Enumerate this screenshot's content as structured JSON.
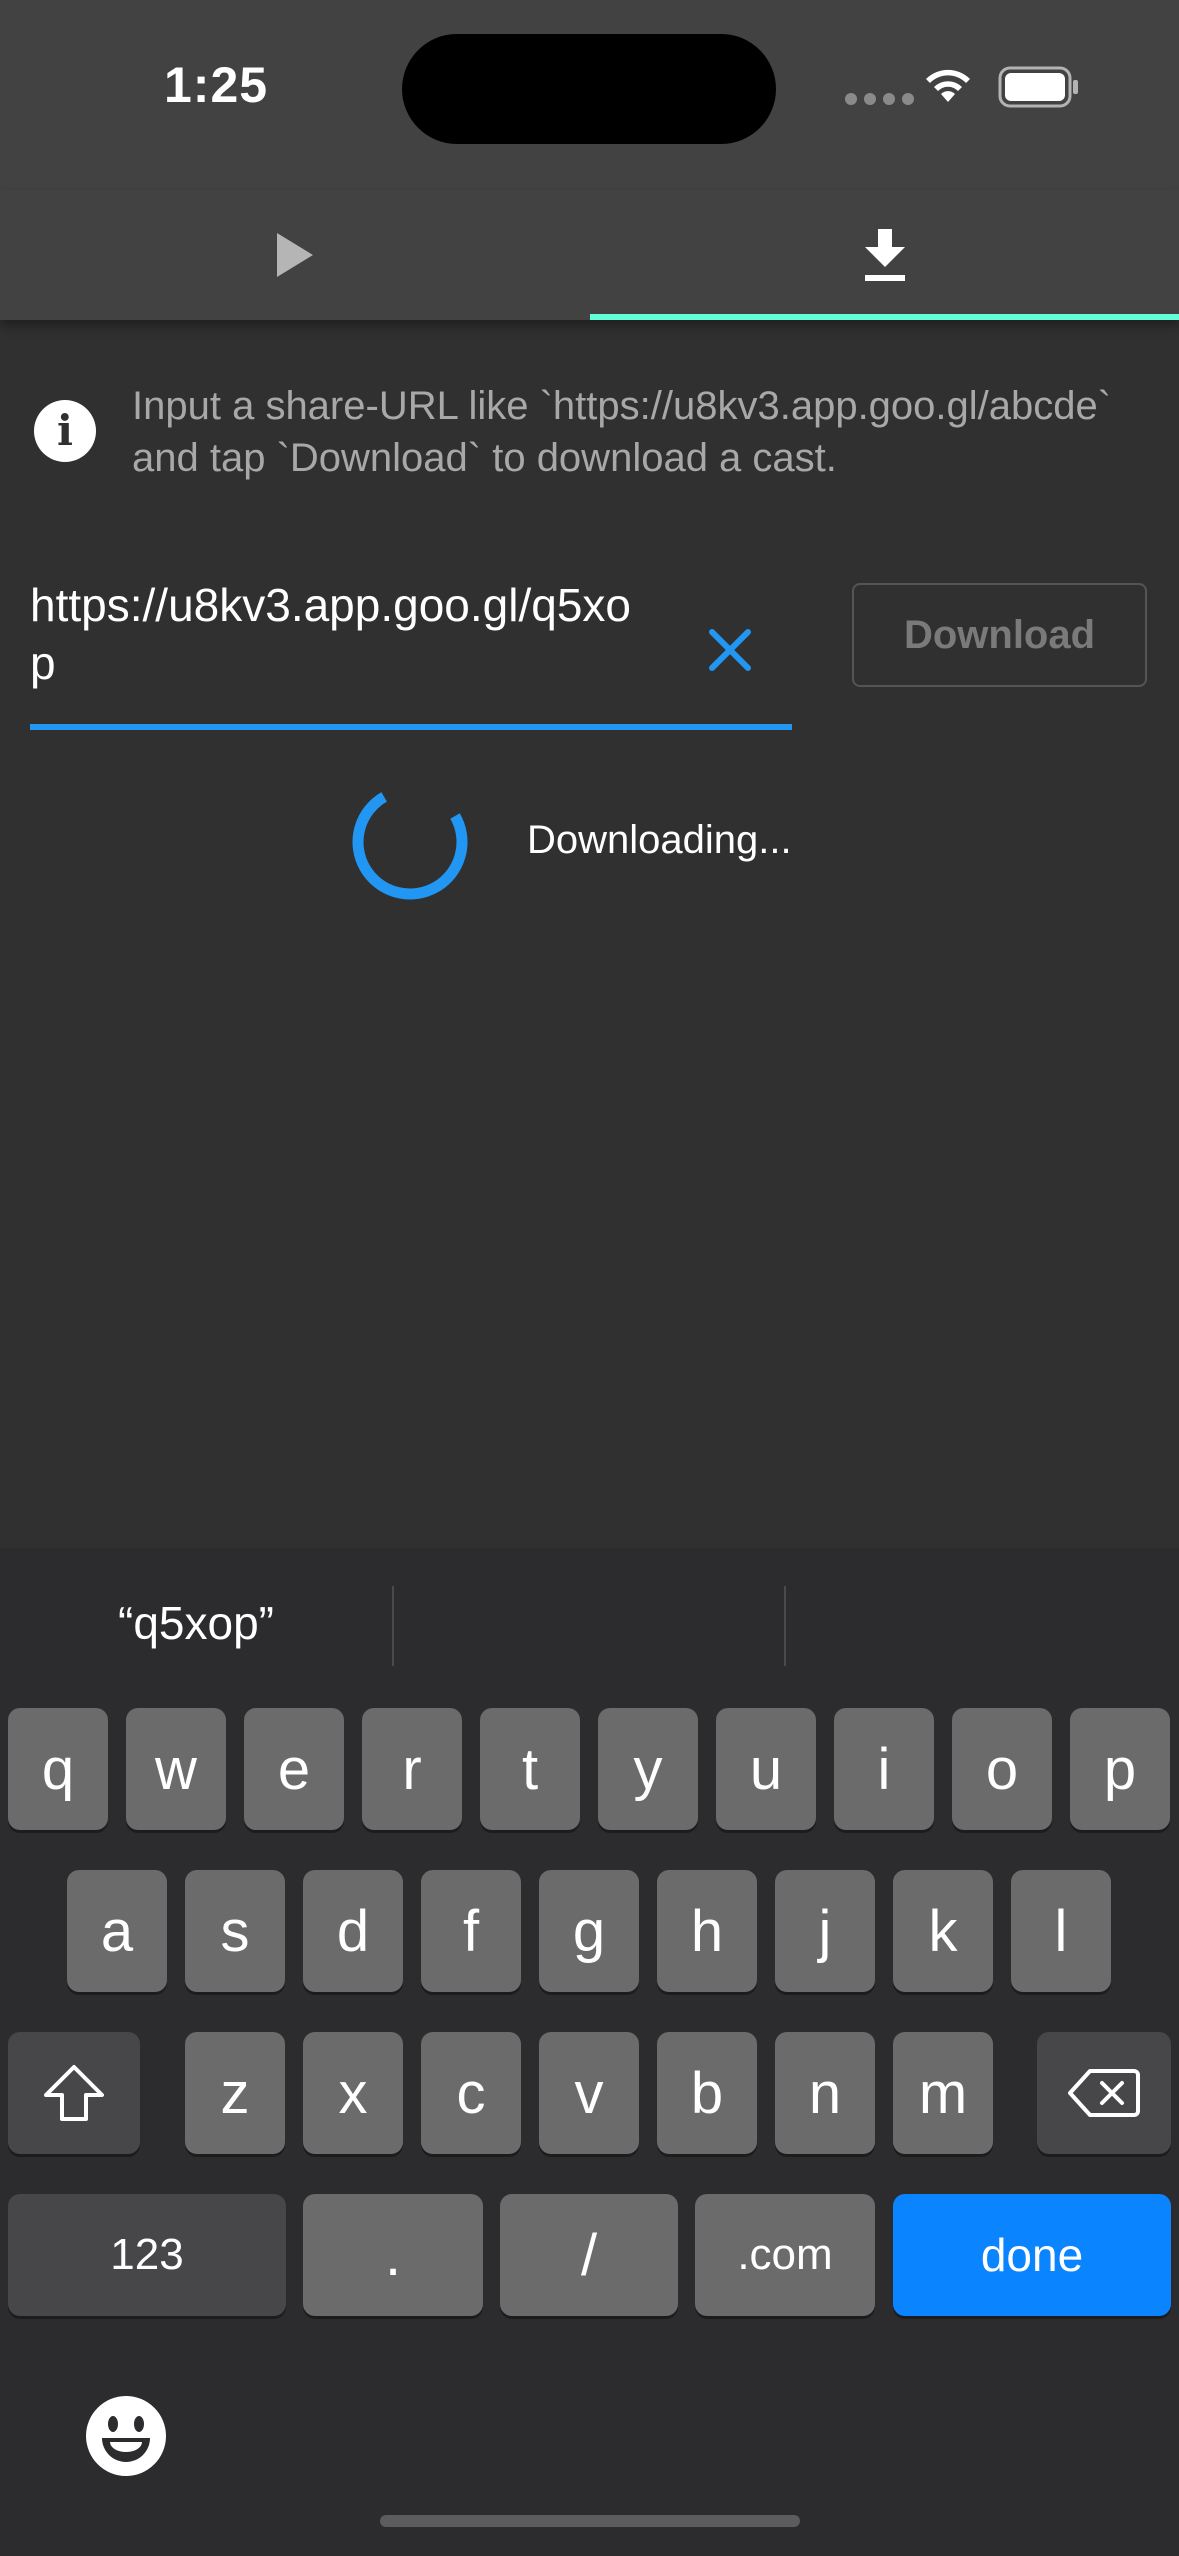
{
  "status_bar": {
    "time": "1:25"
  },
  "tabs": [
    {
      "icon": "play-icon",
      "selected": false
    },
    {
      "icon": "download-icon",
      "selected": true
    }
  ],
  "colors": {
    "accent": "#2196f3",
    "tab_indicator": "#64ffda",
    "done_key": "#0a84ff"
  },
  "info": {
    "icon": "info-icon",
    "text": "Input a share-URL like `https://u8kv3.app.goo.gl/abcde` and tap `Download` to download a cast."
  },
  "url_input": {
    "value": "https://u8kv3.app.goo.gl/q5xop",
    "clear_icon": "close-icon"
  },
  "download_button": {
    "label": "Download",
    "enabled": false
  },
  "status": {
    "label": "Downloading..."
  },
  "keyboard": {
    "suggestions": [
      "“q5xop”",
      "",
      ""
    ],
    "row1": [
      "q",
      "w",
      "e",
      "r",
      "t",
      "y",
      "u",
      "i",
      "o",
      "p"
    ],
    "row2": [
      "a",
      "s",
      "d",
      "f",
      "g",
      "h",
      "j",
      "k",
      "l"
    ],
    "row3": [
      "z",
      "x",
      "c",
      "v",
      "b",
      "n",
      "m"
    ],
    "numbers_key": "123",
    "dot_key": ".",
    "slash_key": "/",
    "dotcom_key": ".com",
    "done_key": "done"
  }
}
